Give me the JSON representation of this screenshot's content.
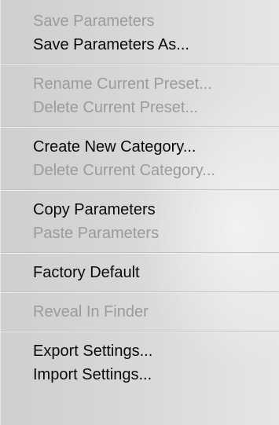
{
  "menu": {
    "groups": [
      {
        "items": [
          {
            "label": "Save Parameters",
            "enabled": false
          },
          {
            "label": "Save Parameters As...",
            "enabled": true
          }
        ]
      },
      {
        "items": [
          {
            "label": "Rename Current Preset...",
            "enabled": false
          },
          {
            "label": "Delete Current Preset...",
            "enabled": false
          }
        ]
      },
      {
        "items": [
          {
            "label": "Create New Category...",
            "enabled": true
          },
          {
            "label": "Delete Current Category...",
            "enabled": false
          }
        ]
      },
      {
        "items": [
          {
            "label": "Copy Parameters",
            "enabled": true
          },
          {
            "label": "Paste Parameters",
            "enabled": false
          }
        ]
      },
      {
        "items": [
          {
            "label": "Factory Default",
            "enabled": true
          }
        ]
      },
      {
        "items": [
          {
            "label": "Reveal In Finder",
            "enabled": false
          }
        ]
      },
      {
        "items": [
          {
            "label": "Export Settings...",
            "enabled": true
          },
          {
            "label": "Import Settings...",
            "enabled": true
          }
        ]
      }
    ]
  }
}
